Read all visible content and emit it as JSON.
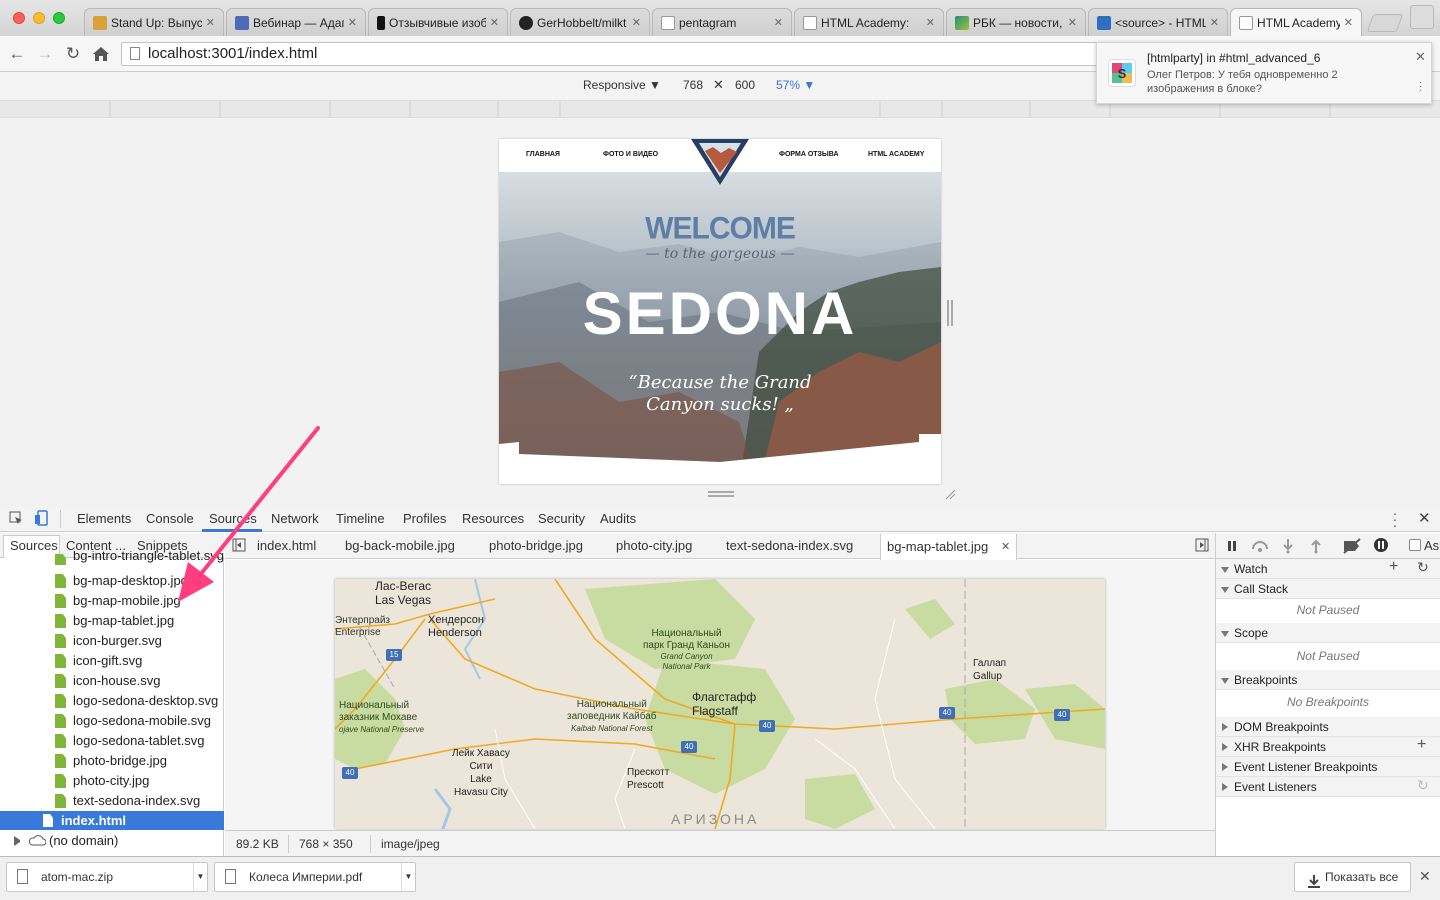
{
  "tabs": [
    {
      "title": "Stand Up: Выпуск",
      "active": false
    },
    {
      "title": "Вебинар — Адап",
      "active": false
    },
    {
      "title": "Отзывчивые изоб",
      "active": false
    },
    {
      "title": "GerHobbelt/milkt",
      "active": false
    },
    {
      "title": "pentagram",
      "active": false
    },
    {
      "title": "HTML Academy: ",
      "active": false
    },
    {
      "title": "РБК — новости,",
      "active": false
    },
    {
      "title": "<source> - HTML",
      "active": false
    },
    {
      "title": "HTML Academy: ",
      "active": true
    }
  ],
  "address": {
    "url": "localhost:3001/index.html"
  },
  "device": {
    "mode": "Responsive ▼",
    "width": "768",
    "times": "✕",
    "height": "600",
    "zoom": "57% ▼"
  },
  "site": {
    "nav": [
      "ГЛАВНАЯ",
      "ФОТО И ВИДЕО",
      "ФОРМА ОТЗЫВА",
      "HTML ACADEMY"
    ],
    "logo_text": "CITY OF SEDONA",
    "welcome": "WELCOME",
    "gorgeous": "— to the gorgeous —",
    "sedona": "SEDONA",
    "quote_line1": "“Because the Grand",
    "quote_line2": "Canyon sucks! „"
  },
  "devtools": {
    "main_tabs": [
      "Elements",
      "Console",
      "Sources",
      "Network",
      "Timeline",
      "Profiles",
      "Resources",
      "Security",
      "Audits"
    ],
    "active_tab": "Sources",
    "navigator_tabs": [
      "Sources",
      "Content ...",
      "Snippets"
    ],
    "files": [
      "bg-intro-triangle-tablet.svg",
      "bg-map-desktop.jpg",
      "bg-map-mobile.jpg",
      "bg-map-tablet.jpg",
      "icon-burger.svg",
      "icon-gift.svg",
      "icon-house.svg",
      "logo-sedona-desktop.svg",
      "logo-sedona-mobile.svg",
      "logo-sedona-tablet.svg",
      "photo-bridge.jpg",
      "photo-city.jpg",
      "text-sedona-index.svg"
    ],
    "selected_file": "index.html",
    "no_domain": "(no domain)",
    "editor_tabs": [
      "index.html",
      "bg-back-mobile.jpg",
      "photo-bridge.jpg",
      "photo-city.jpg",
      "text-sedona-index.svg",
      "bg-map-tablet.jpg"
    ],
    "status": {
      "size": "89.2 KB",
      "dims": "768 × 350",
      "type": "image/jpeg"
    },
    "debugger": {
      "watch": "Watch",
      "call_stack": "Call Stack",
      "not_paused": "Not Paused",
      "scope": "Scope",
      "breakpoints": "Breakpoints",
      "no_breakpoints": "No Breakpoints",
      "dom_breakpoints": "DOM Breakpoints",
      "xhr_breakpoints": "XHR Breakpoints",
      "event_listener_breakpoints": "Event Listener Breakpoints",
      "event_listeners": "Event Listeners",
      "async": "As"
    }
  },
  "map_labels": {
    "lasvegas_ru": "Лас-Вегас",
    "lasvegas": "Las Vegas",
    "enterprise_ru": "Энтерпрайз",
    "enterprise": "Enterprise",
    "henderson_ru": "Хендерсон",
    "henderson": "Henderson",
    "gc_ru1": "Национальный",
    "gc_ru2": "парк Гранд Каньон",
    "gc_en1": "Grand Canyon",
    "gc_en2": "National Park",
    "mojave_ru1": "Национальный",
    "mojave_ru2": "заказник Мохаве",
    "mojave_en": "ojave National Preserve",
    "kaibab_ru1": "Национальный",
    "kaibab_ru2": "заповедник Кайбаб",
    "kaibab_en": "Kaibab National Forest",
    "flagstaff_ru": "Флагстафф",
    "flagstaff": "Flagstaff",
    "gallup_ru": "Галлап",
    "gallup": "Gallup",
    "lakehavasu_ru1": "Лейк Хавасу",
    "lakehavasu_ru2": "Сити",
    "lakehavasu_en1": "Lake",
    "lakehavasu_en2": "Havasu City",
    "prescott_ru": "Прескотт",
    "prescott": "Prescott",
    "arizona": "АРИЗОНА",
    "shields": [
      "15",
      "40",
      "40",
      "40",
      "40",
      "40"
    ]
  },
  "notification": {
    "title": "[htmlparty] in #html_advanced_6",
    "body": "Олег Петров: У тебя одновременно 2 изображения в блоке?"
  },
  "downloads": {
    "item1": "atom-mac.zip",
    "item2": "Колеса Империи.pdf",
    "show_all": "Показать все"
  },
  "colors": {
    "accent": "#ff3d7f",
    "selection": "#3879d9",
    "file_icon": "#7fb539"
  }
}
